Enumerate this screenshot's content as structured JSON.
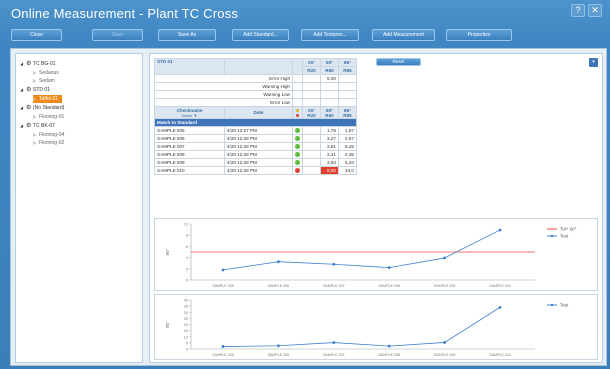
{
  "window": {
    "title": "Online Measurement - Plant TC Cross",
    "help_label": "?",
    "close_label": "✕"
  },
  "toolbar": {
    "buttons": [
      {
        "label": "Close",
        "enabled": true
      },
      {
        "label": "Save",
        "enabled": false
      },
      {
        "label": "Save As",
        "enabled": true
      },
      {
        "label": "Add Standard...",
        "enabled": true
      },
      {
        "label": "Add Textures...",
        "enabled": true
      },
      {
        "label": "Add Measurement",
        "enabled": true
      },
      {
        "label": "Properties",
        "enabled": true
      }
    ]
  },
  "tree": {
    "items": [
      {
        "label": "TC BG-01",
        "level": 0,
        "icon": "gear-icon"
      },
      {
        "label": "Sedanus",
        "level": 1
      },
      {
        "label": "Sedam",
        "level": 1
      },
      {
        "label": "STD 01",
        "level": 0,
        "icon": "gear-icon"
      },
      {
        "label": "Taffet 01",
        "level": 1,
        "selected": true
      },
      {
        "label": "(No Standard)",
        "level": 0,
        "icon": "gear-icon"
      },
      {
        "label": "Flooring-01",
        "level": 1
      },
      {
        "label": "TC BK-07",
        "level": 0,
        "icon": "gear-icon"
      },
      {
        "label": "Flooring-04",
        "level": 1
      },
      {
        "label": "Flooring-02",
        "level": 1
      }
    ]
  },
  "grid": {
    "standard_name": "STD 01",
    "angle_headers": [
      {
        "top": "20°",
        "bottom": "R20"
      },
      {
        "top": "60°",
        "bottom": "R60"
      },
      {
        "top": "85°",
        "bottom": "R85"
      }
    ],
    "limit_rows": [
      {
        "label": "Error High",
        "values": [
          "",
          "5,00",
          ""
        ]
      },
      {
        "label": "Warning High",
        "values": [
          "",
          "",
          ""
        ]
      },
      {
        "label": "Warning Low",
        "values": [
          "",
          "",
          ""
        ]
      },
      {
        "label": "Error Low",
        "values": [
          "",
          "",
          ""
        ]
      }
    ],
    "col_headers": {
      "name": "Checkname",
      "name_sub": "Name ▼",
      "date": "Date"
    },
    "match_label": "Match to Standard",
    "rows": [
      {
        "name": "SAMPLE 005",
        "date": "4/20 12:27 PM",
        "status": "green",
        "v20": "",
        "v60": "1,78",
        "v85": "1,97",
        "alert": false
      },
      {
        "name": "SAMPLE 006",
        "date": "4/20 12:28 PM",
        "status": "green",
        "v20": "",
        "v60": "3,27",
        "v85": "2,67",
        "alert": false
      },
      {
        "name": "SAMPLE 007",
        "date": "4/20 12:28 PM",
        "status": "green",
        "v20": "",
        "v60": "2,81",
        "v85": "5,25",
        "alert": false
      },
      {
        "name": "SAMPLE 008",
        "date": "4/20 12:28 PM",
        "status": "green",
        "v20": "",
        "v60": "2,21",
        "v85": "2,35",
        "alert": false
      },
      {
        "name": "SAMPLE 009",
        "date": "4/20 12:28 PM",
        "status": "green",
        "v20": "",
        "v60": "3,94",
        "v85": "5,34",
        "alert": false
      },
      {
        "name": "SAMPLE 010",
        "date": "4/20 12:28 PM",
        "status": "red",
        "v20": "",
        "v60": "8,92",
        "v85": "34,0",
        "alert": true
      }
    ],
    "reset_label": "Reset",
    "collapse_icon": "chevron-down-icon"
  },
  "colors": {
    "accent": "#3f74b8",
    "selected": "#f08a1c",
    "limit_line": "#e8463e",
    "series": "#3f7fd0",
    "status_green": "#5cbf3a",
    "status_red": "#e04030"
  },
  "chart_data": [
    {
      "type": "line",
      "ylabel": "60°",
      "categories": [
        "SAMPLE 005",
        "SAMPLE 006",
        "SAMPLE 007",
        "SAMPLE 008",
        "SAMPLE 009",
        "SAMPLE 010"
      ],
      "series": [
        {
          "name": "Test",
          "values": [
            1.78,
            3.27,
            2.81,
            2.21,
            3.94,
            8.92
          ]
        }
      ],
      "limit": {
        "name": "Tol+ 60°",
        "value": 5
      },
      "ylim": [
        0,
        10
      ],
      "yticks": [
        0,
        2,
        4,
        6,
        8,
        10
      ],
      "legend": "top-right",
      "grid": false
    },
    {
      "type": "line",
      "ylabel": "85°",
      "categories": [
        "SAMPLE 005",
        "SAMPLE 006",
        "SAMPLE 007",
        "SAMPLE 008",
        "SAMPLE 009",
        "SAMPLE 010"
      ],
      "series": [
        {
          "name": "Test",
          "values": [
            1.97,
            2.67,
            5.25,
            2.35,
            5.34,
            34.0
          ]
        }
      ],
      "ylim": [
        0,
        40
      ],
      "yticks": [
        0,
        5,
        10,
        15,
        20,
        25,
        30,
        35,
        40
      ],
      "legend": "top-right",
      "grid": false
    }
  ]
}
